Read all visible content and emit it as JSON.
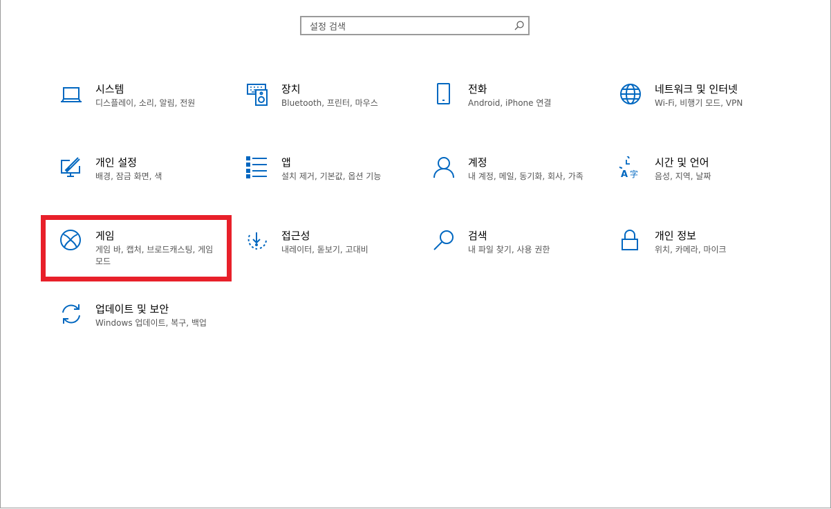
{
  "search": {
    "placeholder": "설정 검색"
  },
  "accent_color": "#0067c0",
  "highlight_color": "#e8202a",
  "tiles": [
    {
      "title": "시스템",
      "desc": "디스플레이, 소리, 알림, 전원",
      "icon": "laptop-icon"
    },
    {
      "title": "장치",
      "desc": "Bluetooth, 프린터, 마우스",
      "icon": "keyboard-speaker-icon"
    },
    {
      "title": "전화",
      "desc": "Android, iPhone 연결",
      "icon": "phone-icon"
    },
    {
      "title": "네트워크 및 인터넷",
      "desc": "Wi-Fi, 비행기 모드, VPN",
      "icon": "globe-icon"
    },
    {
      "title": "개인 설정",
      "desc": "배경, 잠금 화면, 색",
      "icon": "paint-monitor-icon"
    },
    {
      "title": "앱",
      "desc": "설치 제거, 기본값, 옵션 기능",
      "icon": "app-list-icon"
    },
    {
      "title": "계정",
      "desc": "내 계정, 메일, 동기화, 회사, 가족",
      "icon": "person-icon"
    },
    {
      "title": "시간 및 언어",
      "desc": "음성, 지역, 날짜",
      "icon": "time-language-icon"
    },
    {
      "title": "게임",
      "desc": "게임 바, 캡처, 브로드캐스팅, 게임 모드",
      "icon": "xbox-icon"
    },
    {
      "title": "접근성",
      "desc": "내레이터, 돋보기, 고대비",
      "icon": "ease-of-access-icon"
    },
    {
      "title": "검색",
      "desc": "내 파일 찾기, 사용 권한",
      "icon": "search-icon"
    },
    {
      "title": "개인 정보",
      "desc": "위치, 카메라, 마이크",
      "icon": "lock-icon"
    },
    {
      "title": "업데이트 및 보안",
      "desc": "Windows 업데이트, 복구, 백업",
      "icon": "sync-icon"
    }
  ]
}
